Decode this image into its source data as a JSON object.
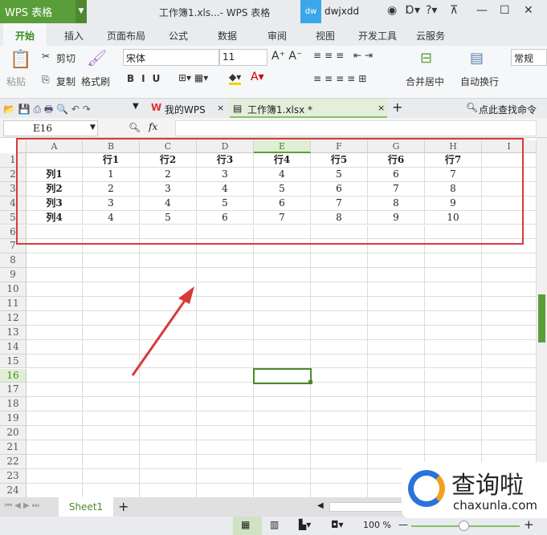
{
  "app": {
    "name": "WPS 表格",
    "window_title": "工作簿1.xls...- WPS 表格",
    "user_badge": "dw",
    "user": "dwjxdd"
  },
  "menu_tabs": [
    "开始",
    "插入",
    "页面布局",
    "公式",
    "数据",
    "审阅",
    "视图",
    "开发工具",
    "云服务"
  ],
  "ribbon": {
    "paste": "粘贴",
    "cut": "剪切",
    "copy": "复制",
    "format_painter": "格式刷",
    "font": "宋体",
    "font_size": "11",
    "merge": "合并居中",
    "wrap": "自动换行",
    "number_format": "常规"
  },
  "doc_tabs": {
    "home": "我的WPS",
    "file": "工作簿1.xlsx *",
    "search": "点此查找命令"
  },
  "formula_bar": {
    "name_box": "E16",
    "fx": "fx",
    "value": ""
  },
  "columns": [
    "A",
    "B",
    "C",
    "D",
    "E",
    "F",
    "G",
    "H",
    "I"
  ],
  "rows": [
    "1",
    "2",
    "3",
    "4",
    "5",
    "6",
    "7",
    "8",
    "9",
    "10",
    "11",
    "12",
    "13",
    "14",
    "15",
    "16",
    "17",
    "18",
    "19",
    "20",
    "21",
    "22",
    "23",
    "24"
  ],
  "cells": [
    [
      "",
      "行1",
      "行2",
      "行3",
      "行4",
      "行5",
      "行6",
      "行7",
      ""
    ],
    [
      "列1",
      "1",
      "2",
      "3",
      "4",
      "5",
      "6",
      "7",
      ""
    ],
    [
      "列2",
      "2",
      "3",
      "4",
      "5",
      "6",
      "7",
      "8",
      ""
    ],
    [
      "列3",
      "3",
      "4",
      "5",
      "6",
      "7",
      "8",
      "9",
      ""
    ],
    [
      "列4",
      "4",
      "5",
      "6",
      "7",
      "8",
      "9",
      "10",
      ""
    ]
  ],
  "sheets": [
    "Sheet1"
  ],
  "status": {
    "zoom": "100 %"
  },
  "watermark": {
    "name": "查询啦",
    "url": "chaxunla.com"
  },
  "colors": {
    "accent": "#5a9e3a",
    "annotation": "#d9393b"
  }
}
